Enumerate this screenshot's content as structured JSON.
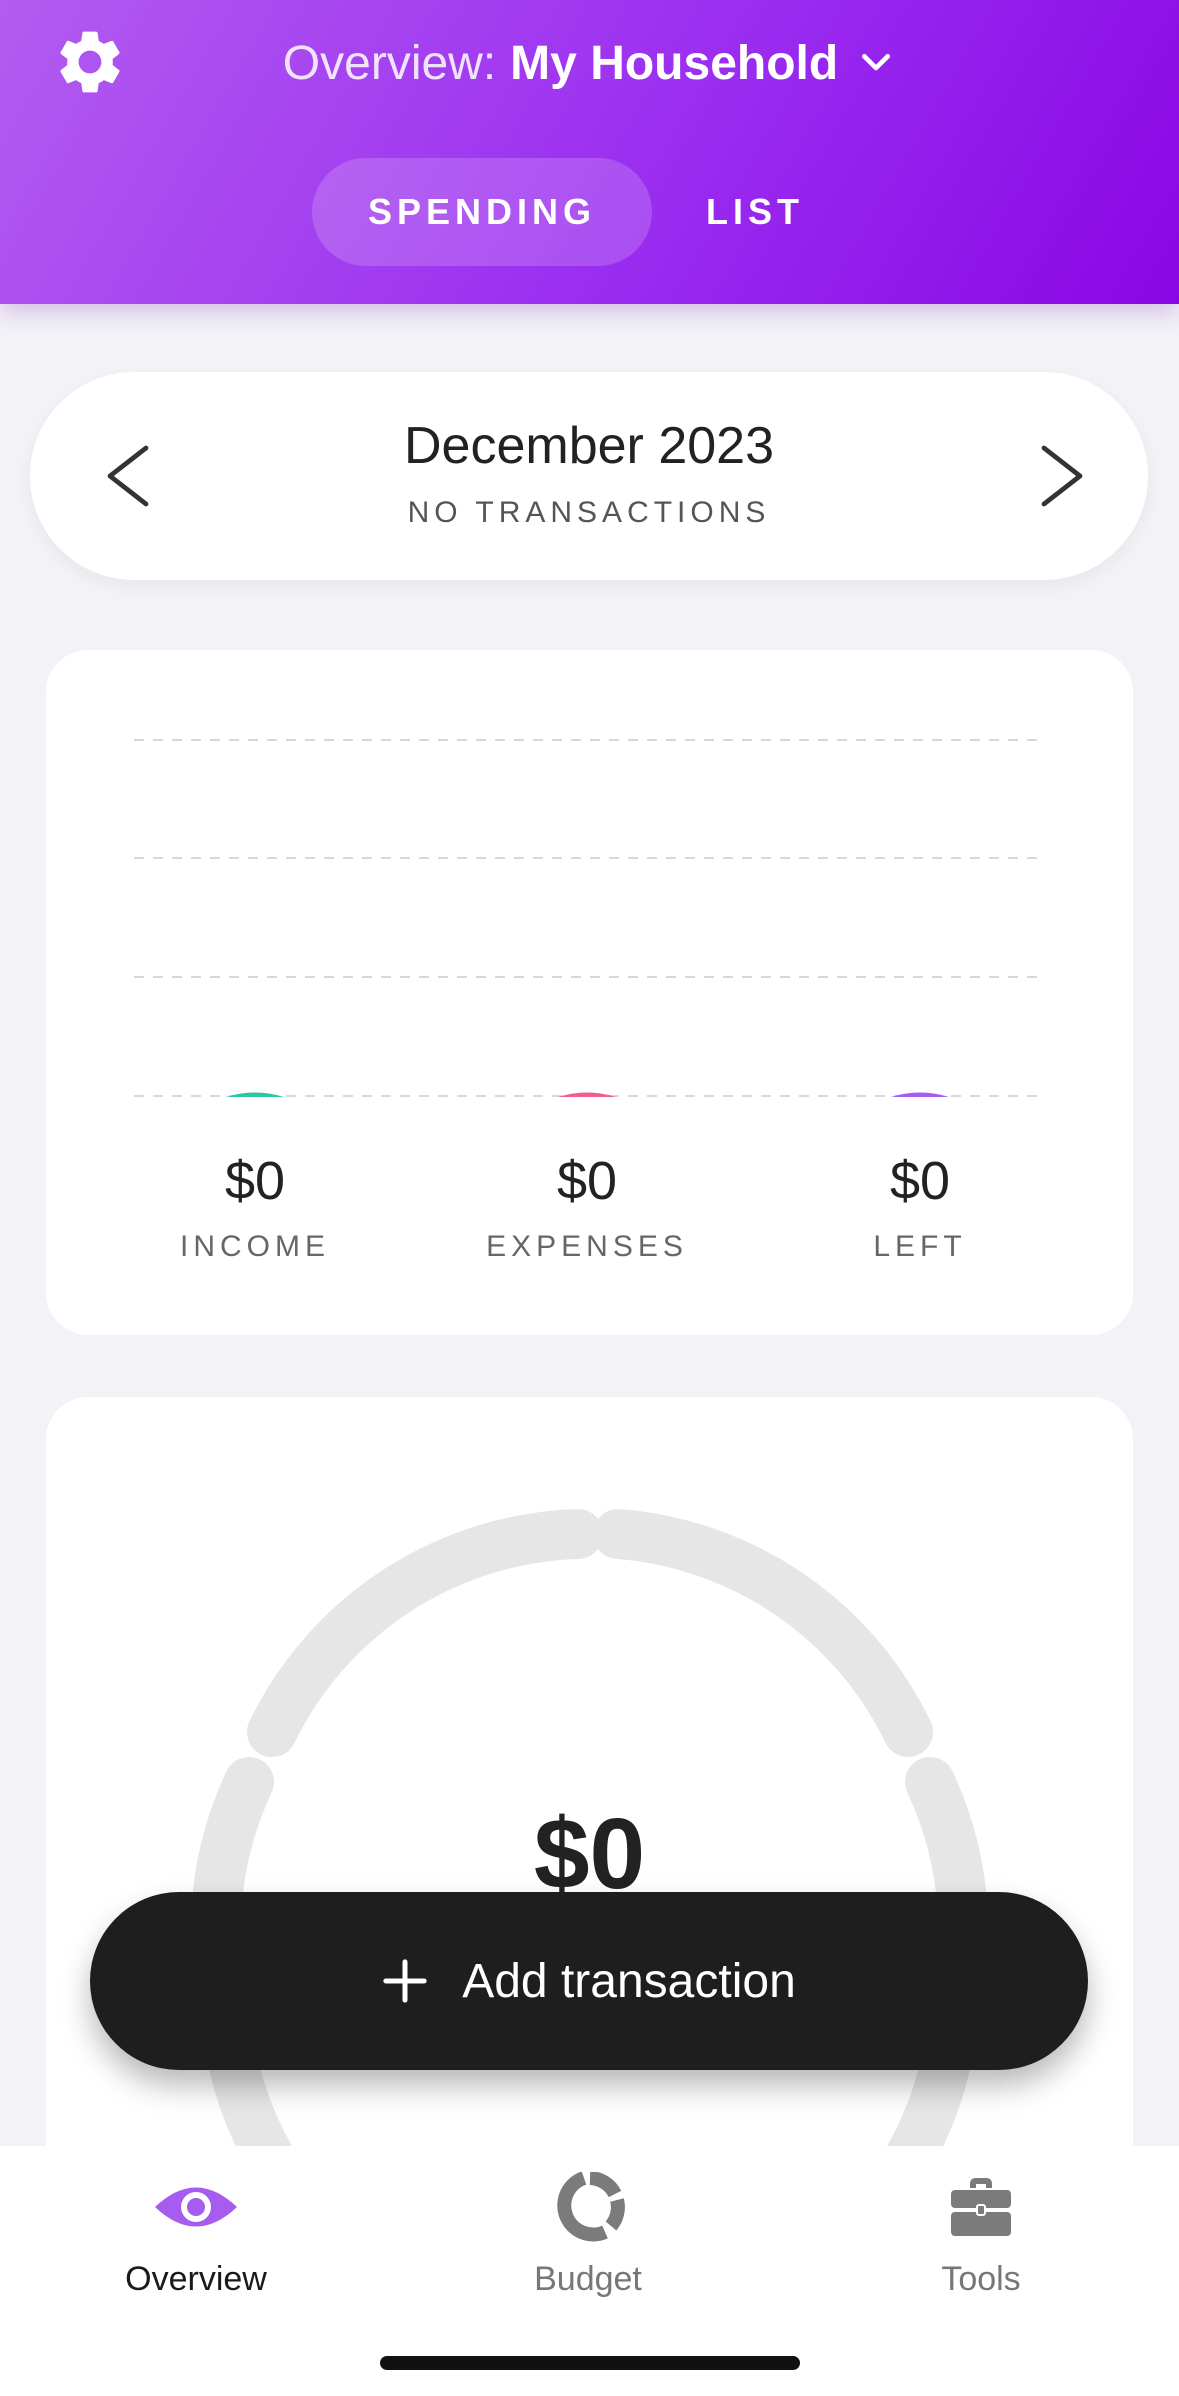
{
  "header": {
    "title_prefix": "Overview:",
    "household_name": "My Household",
    "settings_icon": "gear-icon",
    "dropdown_icon": "chevron-down-icon",
    "tabs": [
      {
        "label": "SPENDING",
        "active": true
      },
      {
        "label": "LIST",
        "active": false
      }
    ],
    "colors": {
      "gradient_start": "#b25cf0",
      "gradient_end": "#8a06e6"
    }
  },
  "month": {
    "title": "December 2023",
    "subtitle": "NO TRANSACTIONS",
    "prev_icon": "chevron-left-icon",
    "next_icon": "chevron-right-icon"
  },
  "summary": {
    "stats": [
      {
        "value": "$0",
        "label": "INCOME",
        "color": "#2bc6a4"
      },
      {
        "value": "$0",
        "label": "EXPENSES",
        "color": "#ef5d8f"
      },
      {
        "value": "$0",
        "label": "LEFT",
        "color": "#a75cf0"
      }
    ]
  },
  "budget": {
    "total": "$0"
  },
  "add_button": {
    "label": "Add transaction",
    "icon": "plus-icon"
  },
  "tabbar": {
    "items": [
      {
        "label": "Overview",
        "icon": "eye-icon",
        "active": true
      },
      {
        "label": "Budget",
        "icon": "donut-chart-icon",
        "active": false
      },
      {
        "label": "Tools",
        "icon": "briefcase-icon",
        "active": false
      }
    ],
    "active_color": "#a75cf0"
  }
}
